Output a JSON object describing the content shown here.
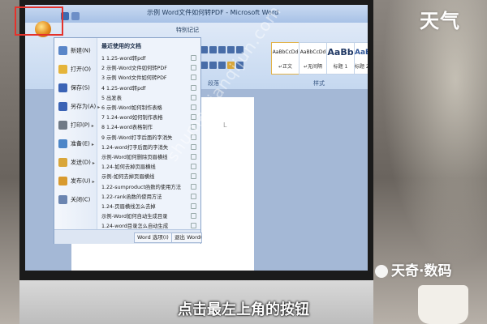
{
  "window": {
    "title": "示例 Word文件如何转PDF - Microsoft Word",
    "tab_visible": "特别记记",
    "groups": {
      "paragraph": "段落",
      "styles": "样式"
    },
    "styles": [
      {
        "preview": "AaBbCcDd",
        "name": "↵正文"
      },
      {
        "preview": "AaBbCcDd",
        "name": "↵无间隔"
      },
      {
        "preview": "AaBb",
        "name": "标题 1"
      },
      {
        "preview": "AaBbC",
        "name": "标题 2"
      },
      {
        "preview": "Aa",
        "name": "标"
      }
    ]
  },
  "office_menu": {
    "left_items": [
      {
        "label": "新建(N)",
        "icon": "new-doc-icon",
        "color": "#5a86c8",
        "submenu": false
      },
      {
        "label": "打开(O)",
        "icon": "open-folder-icon",
        "color": "#e5b43a",
        "submenu": false
      },
      {
        "label": "保存(S)",
        "icon": "save-icon",
        "color": "#3b63b5",
        "submenu": false
      },
      {
        "label": "另存为(A)",
        "icon": "save-as-icon",
        "color": "#3b63b5",
        "submenu": true
      },
      {
        "label": "打印(P)",
        "icon": "print-icon",
        "color": "#707a86",
        "submenu": true
      },
      {
        "label": "准备(E)",
        "icon": "prepare-icon",
        "color": "#4d86c8",
        "submenu": true
      },
      {
        "label": "发送(D)",
        "icon": "send-icon",
        "color": "#d9a63a",
        "submenu": true
      },
      {
        "label": "发布(U)",
        "icon": "publish-icon",
        "color": "#d89a2e",
        "submenu": true
      },
      {
        "label": "关闭(C)",
        "icon": "close-doc-icon",
        "color": "#6b85b0",
        "submenu": false
      }
    ],
    "recent_title": "最近使用的文档",
    "recent_docs": [
      "1 1.25-word转pdf",
      "2 示例-Word文件如何转PDF",
      "3 示例 Word文件如何转PDF",
      "4 1.25-word转pdf",
      "5 出发表",
      "6 示例-Word如何制作表格",
      "7 1.24-word如何制作表格",
      "8 1.24-word表格制作",
      "9 示例-Word打字后面的字消失",
      "1.24-word打字后面的字消失",
      "示例-Word如何删除页眉横线",
      "1.24-如何去掉页眉横线",
      "示例-如何去掉页眉横线",
      "1.22-sumproduct函数的使用方法",
      "1.22-rank函数的使用方法",
      "1.24-页眉横线怎么去掉",
      "示例-Word如何自动生成目录",
      "1.24-word目录怎么自动生成"
    ],
    "bottom_buttons": [
      "Word 选项(I)",
      "退出 Word(X)"
    ]
  },
  "overlay": {
    "logo": "天气",
    "brand": "天奇·数码",
    "watermark": "shuma.tianqijun.com",
    "subtitle": "点击最左上角的按钮",
    "highlight_color": "#e4322b"
  }
}
